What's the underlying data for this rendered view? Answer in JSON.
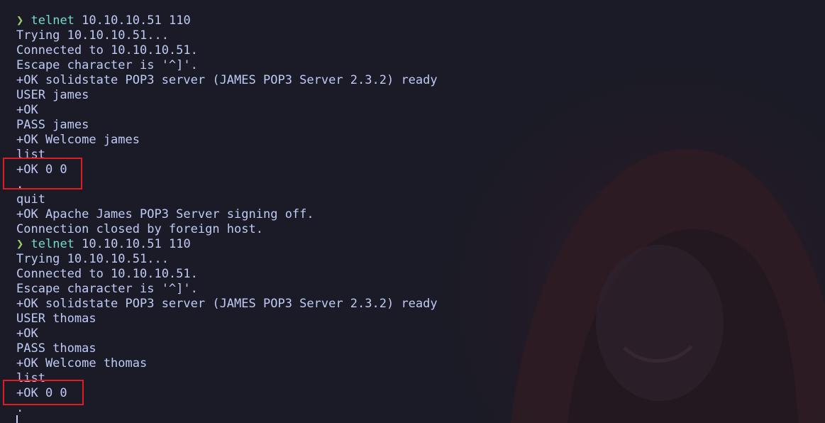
{
  "terminal": {
    "prompt_symbol": "❯",
    "lines": [
      {
        "kind": "prompt",
        "command": "telnet",
        "args": " 10.10.10.51 110"
      },
      {
        "kind": "text",
        "text": "Trying 10.10.10.51..."
      },
      {
        "kind": "text",
        "text": "Connected to 10.10.10.51."
      },
      {
        "kind": "text",
        "text": "Escape character is '^]'."
      },
      {
        "kind": "text",
        "text": "+OK solidstate POP3 server (JAMES POP3 Server 2.3.2) ready"
      },
      {
        "kind": "text",
        "text": "USER james"
      },
      {
        "kind": "text",
        "text": "+OK"
      },
      {
        "kind": "text",
        "text": "PASS james"
      },
      {
        "kind": "text",
        "text": "+OK Welcome james"
      },
      {
        "kind": "text",
        "text": "list"
      },
      {
        "kind": "text",
        "text": "+OK 0 0"
      },
      {
        "kind": "text",
        "text": "."
      },
      {
        "kind": "text",
        "text": "quit"
      },
      {
        "kind": "text",
        "text": "+OK Apache James POP3 Server signing off."
      },
      {
        "kind": "text",
        "text": "Connection closed by foreign host."
      },
      {
        "kind": "prompt",
        "command": "telnet",
        "args": " 10.10.10.51 110"
      },
      {
        "kind": "text",
        "text": "Trying 10.10.10.51..."
      },
      {
        "kind": "text",
        "text": "Connected to 10.10.10.51."
      },
      {
        "kind": "text",
        "text": "Escape character is '^]'."
      },
      {
        "kind": "text",
        "text": "+OK solidstate POP3 server (JAMES POP3 Server 2.3.2) ready"
      },
      {
        "kind": "text",
        "text": "USER thomas"
      },
      {
        "kind": "text",
        "text": "+OK"
      },
      {
        "kind": "text",
        "text": "PASS thomas"
      },
      {
        "kind": "text",
        "text": "+OK Welcome thomas"
      },
      {
        "kind": "text",
        "text": "list"
      },
      {
        "kind": "text",
        "text": "+OK 0 0"
      },
      {
        "kind": "text",
        "text": "."
      }
    ]
  },
  "colors": {
    "background": "#1a1b26",
    "foreground": "#c0caf5",
    "prompt_symbol": "#9ece6a",
    "command": "#73daca",
    "highlight_box": "#e01b24"
  },
  "icons": {
    "wallpaper": "hooded-figure"
  }
}
